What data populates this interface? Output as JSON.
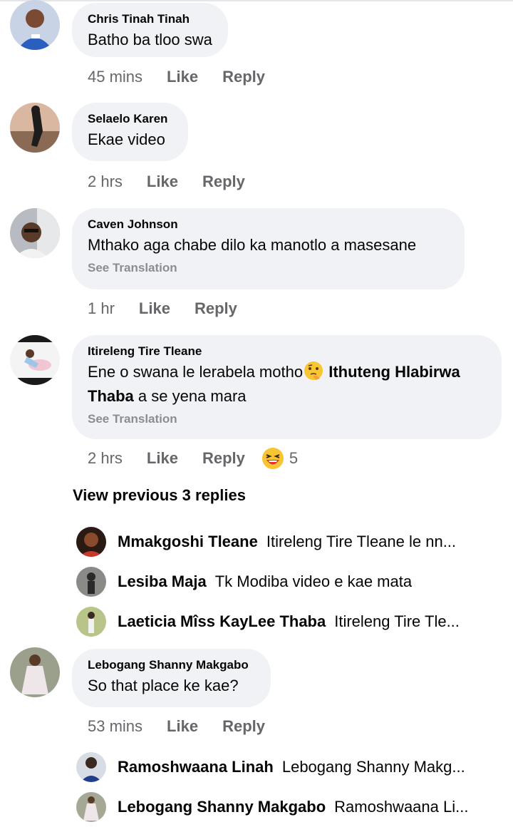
{
  "comments": [
    {
      "author": "Chris Tinah Tinah",
      "text": "Batho ba tloo swa",
      "time": "45 mins",
      "like": "Like",
      "reply": "Reply"
    },
    {
      "author": "Selaelo Karen",
      "text": "Ekae video",
      "time": "2 hrs",
      "like": "Like",
      "reply": "Reply"
    },
    {
      "author": "Caven Johnson",
      "text": "Mthako aga chabe dilo ka manotlo a masesane",
      "see_translation": "See Translation",
      "time": "1 hr",
      "like": "Like",
      "reply": "Reply"
    },
    {
      "author": "Itireleng Tire Tleane",
      "text_before": "Ene o swana le lerabela motho",
      "emoji": "thinking-face-emoji",
      "mention": "Ithuteng Hlabirwa Thaba",
      "text_after": " a se yena mara",
      "see_translation": "See Translation",
      "time": "2 hrs",
      "like": "Like",
      "reply": "Reply",
      "reaction_icon": "laughing-face-emoji",
      "reaction_count": "5"
    },
    {
      "author": "Lebogang Shanny Makgabo",
      "text": "So that place ke kae?",
      "time": "53 mins",
      "like": "Like",
      "reply": "Reply"
    }
  ],
  "view_previous": "View previous 3 replies",
  "replies_group_1": [
    {
      "name": "Mmakgoshi Tleane",
      "text": "Itireleng Tire Tleane le nn..."
    },
    {
      "name": "Lesiba Maja",
      "text": "Tk Modiba video e kae mata"
    },
    {
      "name": "Laeticia Mîss KayLee Thaba",
      "text": "Itireleng Tire Tle..."
    }
  ],
  "replies_group_2": [
    {
      "name": "Ramoshwaana Linah",
      "text": "Lebogang Shanny Makg..."
    },
    {
      "name": "Lebogang Shanny Makgabo",
      "text": "Ramoshwaana Li..."
    }
  ],
  "colors": {
    "bubble_bg": "#f0f2f5",
    "secondary_text": "#65676b",
    "translation_text": "#8a8d91"
  }
}
